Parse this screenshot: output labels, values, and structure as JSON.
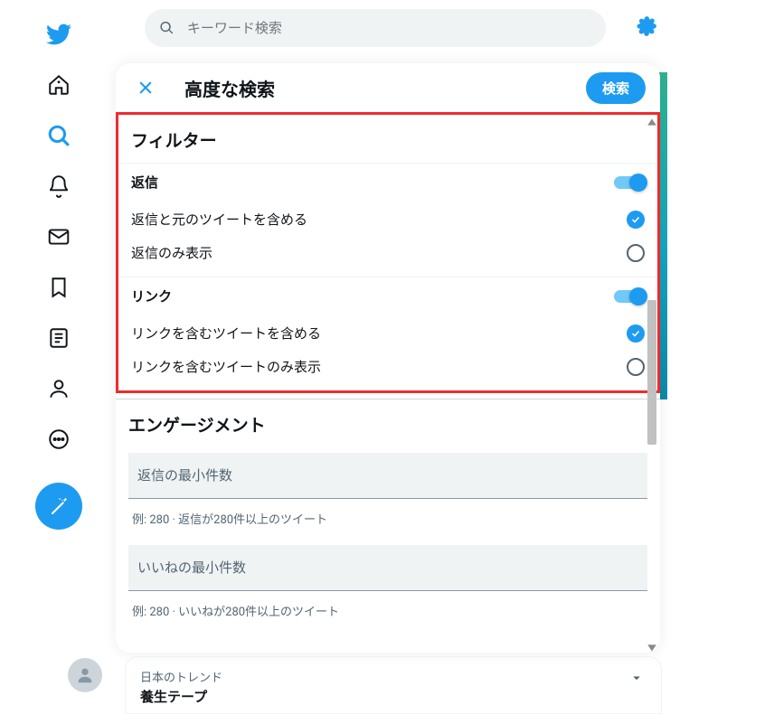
{
  "search": {
    "placeholder": "キーワード検索"
  },
  "modal": {
    "title": "高度な検索",
    "search_button": "検索"
  },
  "filter": {
    "heading": "フィルター",
    "replies": {
      "label": "返信",
      "option_include": "返信と元のツイートを含める",
      "option_only": "返信のみ表示"
    },
    "links": {
      "label": "リンク",
      "option_include": "リンクを含むツイートを含める",
      "option_only": "リンクを含むツイートのみ表示"
    }
  },
  "engagement": {
    "heading": "エンゲージメント",
    "min_replies_placeholder": "返信の最小件数",
    "min_replies_hint": "例: 280 · 返信が280件以上のツイート",
    "min_likes_placeholder": "いいねの最小件数",
    "min_likes_hint": "例: 280 · いいねが280件以上のツイート"
  },
  "trend": {
    "location": "日本のトレンド",
    "name": "養生テープ"
  }
}
